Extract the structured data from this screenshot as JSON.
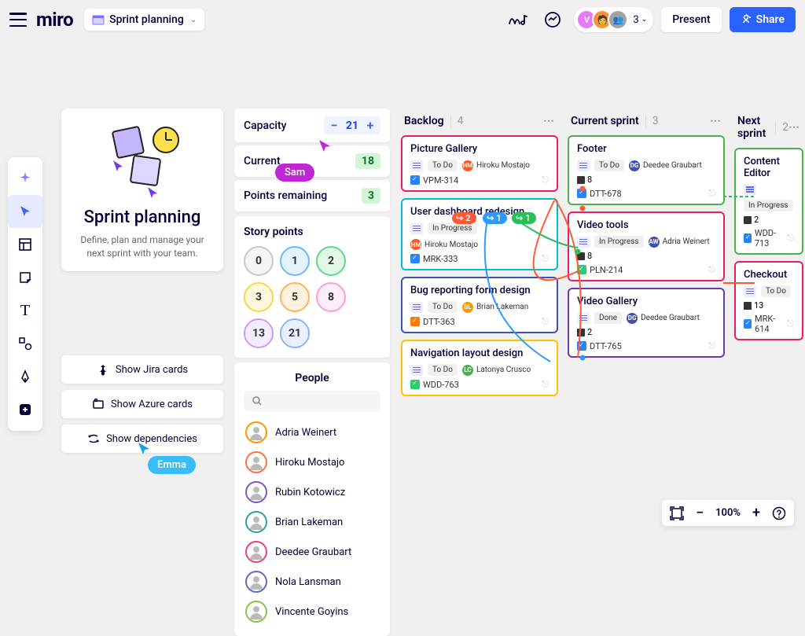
{
  "header": {
    "logo": "miro",
    "board_name": "Sprint planning",
    "present": "Present",
    "share": "Share",
    "user_count": "3"
  },
  "sprint_card": {
    "title": "Sprint planning",
    "desc": "Define, plan and manage your next sprint with your team."
  },
  "actions": {
    "jira": "Show Jira cards",
    "azure": "Show Azure cards",
    "deps": "Show dependencies"
  },
  "capacity": {
    "capacity_label": "Capacity",
    "capacity_value": "21",
    "current_label": "Current",
    "current_value": "18",
    "remaining_label": "Points remaining",
    "remaining_value": "3"
  },
  "story_points": {
    "label": "Story points",
    "values": [
      "0",
      "1",
      "2",
      "3",
      "5",
      "8",
      "13",
      "21"
    ],
    "colors": [
      "#c8c8c8",
      "#6fb8ff",
      "#5fd88a",
      "#f5d948",
      "#ffb35c",
      "#ff9dd6",
      "#c59dff",
      "#8fb1ff"
    ]
  },
  "people": {
    "label": "People",
    "list": [
      {
        "name": "Adria Weinert",
        "ring": "#ff9800"
      },
      {
        "name": "Hiroku Mostajo",
        "ring": "#ff7043"
      },
      {
        "name": "Rubin Kotowicz",
        "ring": "#7e57c2"
      },
      {
        "name": "Brian Lakeman",
        "ring": "#26a69a"
      },
      {
        "name": "Deedee Graubart",
        "ring": "#ec407a"
      },
      {
        "name": "Nola Lansman",
        "ring": "#5c6bc0"
      },
      {
        "name": "Vincente Goyins",
        "ring": "#8bc34a"
      }
    ]
  },
  "columns": [
    {
      "title": "Backlog",
      "count": "4",
      "cards": [
        {
          "title": "Picture Gallery",
          "status": "To Do",
          "assignee": "Hiroku Mostajo",
          "adot": "#ff5722",
          "id": "VPM-314",
          "border": "#e91e63",
          "icon": "blue"
        },
        {
          "title": "User dashboard redesign",
          "status": "In Progress",
          "assignee": "Hiroku Mostajo",
          "adot": "#ff5722",
          "id": "MRK-333",
          "border": "#00bcd4",
          "icon": "blue"
        },
        {
          "title": "Bug reporting form design",
          "status": "To Do",
          "assignee": "Brian Lakeman",
          "adot": "#ff9800",
          "id": "DTT-363",
          "border": "#3f51b5",
          "icon": "orange"
        },
        {
          "title": "Navigation layout design",
          "status": "To Do",
          "assignee": "Latonya Crusco",
          "adot": "#4caf50",
          "id": "WDD-763",
          "border": "#ffc107",
          "icon": "green"
        }
      ]
    },
    {
      "title": "Current sprint",
      "count": "3",
      "cards": [
        {
          "title": "Footer",
          "status": "To Do",
          "assignee": "Deedee Graubart",
          "adot": "#3f51b5",
          "id": "DTT-678",
          "pts": "8",
          "border": "#4caf50",
          "icon": "blue"
        },
        {
          "title": "Video tools",
          "status": "In Progress",
          "assignee": "Adria Weinert",
          "adot": "#3f51b5",
          "id": "PLN-214",
          "pts": "8",
          "border": "#e91e63",
          "icon": "green"
        },
        {
          "title": "Video Gallery",
          "status": "Done",
          "assignee": "Deedee Graubart",
          "adot": "#3f51b5",
          "id": "DTT-765",
          "pts": "2",
          "border": "#673ab7",
          "icon": "blue"
        }
      ]
    },
    {
      "title": "Next sprint",
      "count": "2",
      "cards": [
        {
          "title": "Content Editor",
          "status": "In Progress",
          "id": "WDD-713",
          "pts": "2",
          "border": "#4caf50",
          "icon": "blue",
          "partial": true
        },
        {
          "title": "Checkout",
          "status": "To Do",
          "id": "MRK-614",
          "pts": "13",
          "border": "#e91e63",
          "icon": "blue",
          "partial": true
        }
      ]
    }
  ],
  "cursors": {
    "sam": "Sam",
    "emma": "Emma"
  },
  "dep_pills": {
    "a": "2",
    "b": "1",
    "c": "1"
  },
  "zoom": "100%"
}
